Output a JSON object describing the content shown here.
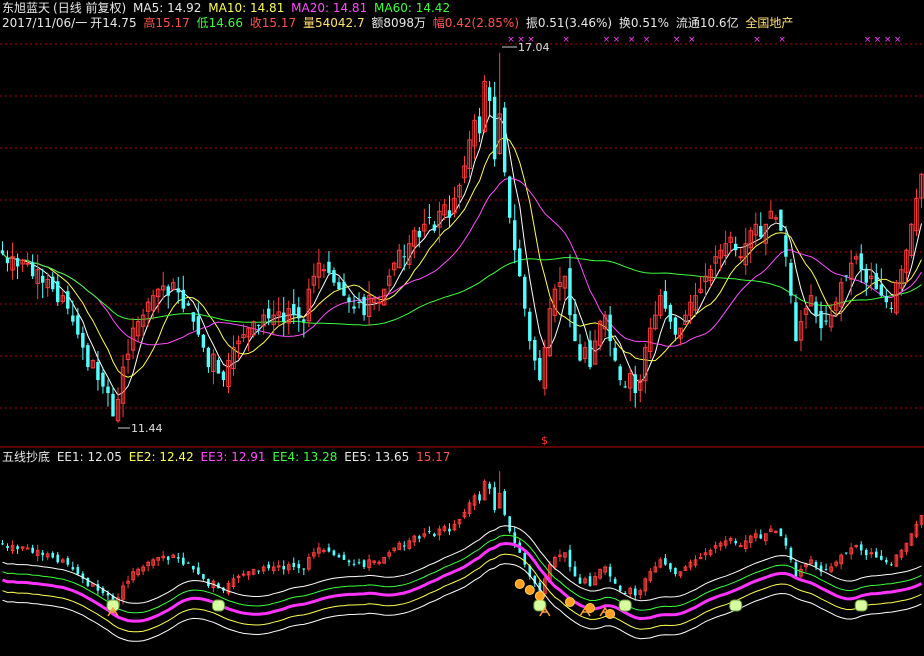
{
  "header": {
    "stock_name": "东旭蓝天",
    "period_label": "(日线 前复权)",
    "ma5": "MA5: 14.92",
    "ma10": "MA10: 14.81",
    "ma20": "MA20: 14.81",
    "ma60": "MA60: 14.42",
    "date": "2017/11/06/一",
    "open": "开14.75",
    "high": "高15.17",
    "low": "低14.66",
    "close": "收15.17",
    "volume": "量54042.7",
    "amount": "额8098万",
    "change": "幅0.42(2.85%)",
    "amplitude": "振0.51(3.46%)",
    "turnover": "换0.51%",
    "float_cap": "流通10.6亿",
    "sector": "全国地产"
  },
  "indicator": {
    "name": "五线抄底",
    "ee1": "EE1: 12.05",
    "ee2": "EE2: 12.42",
    "ee3": "EE3: 12.91",
    "ee4": "EE4: 13.28",
    "ee5": "EE5: 13.65",
    "last": "15.17"
  },
  "colors": {
    "up": "#ff3c3c",
    "down": "#54ffff",
    "ma5": "#ffffff",
    "ma10": "#ffff54",
    "ma20": "#ff4dff",
    "ma60": "#3cff3c",
    "grid": "#b40000",
    "ee_main": "#ff33ff"
  },
  "chart_data": {
    "type": "candlestick",
    "annotations": {
      "max_label": "17.04",
      "min_label": "11.44",
      "marker": "$",
      "x_marks": "×"
    },
    "price_range": [
      11.2,
      17.3
    ],
    "closes": [
      13.95,
      13.8,
      13.9,
      13.75,
      13.85,
      13.8,
      13.6,
      13.7,
      13.5,
      13.55,
      13.4,
      13.2,
      13.3,
      13.1,
      12.9,
      12.7,
      12.5,
      12.2,
      12.3,
      12.0,
      11.9,
      11.8,
      11.44,
      11.7,
      12.2,
      12.4,
      12.8,
      12.9,
      13.0,
      13.2,
      13.3,
      13.4,
      13.45,
      13.3,
      13.5,
      13.35,
      13.1,
      13.15,
      12.9,
      12.7,
      12.5,
      12.2,
      12.4,
      12.1,
      12.0,
      12.3,
      12.5,
      12.6,
      12.7,
      12.8,
      12.9,
      12.85,
      13.0,
      12.95,
      13.0,
      13.05,
      12.9,
      13.1,
      13.0,
      12.95,
      12.9,
      13.4,
      13.6,
      13.8,
      13.7,
      13.65,
      13.5,
      13.4,
      13.3,
      13.2,
      13.1,
      13.2,
      13.0,
      13.3,
      13.25,
      13.2,
      13.4,
      13.6,
      13.8,
      14.0,
      13.9,
      14.1,
      14.3,
      14.2,
      14.4,
      14.5,
      14.3,
      14.6,
      14.7,
      14.5,
      14.8,
      15.0,
      15.3,
      15.7,
      16.0,
      15.8,
      16.6,
      16.3,
      15.4,
      16.1,
      15.2,
      14.5,
      14.0,
      13.6,
      13.1,
      12.6,
      12.3,
      12.0,
      12.5,
      13.1,
      13.4,
      13.5,
      13.6,
      13.0,
      12.6,
      12.3,
      12.5,
      12.2,
      12.6,
      12.9,
      13.0,
      12.6,
      12.3,
      12.0,
      11.9,
      12.1,
      11.8,
      12.0,
      12.5,
      12.8,
      13.0,
      13.3,
      13.1,
      12.9,
      12.7,
      12.8,
      13.0,
      13.2,
      13.3,
      13.4,
      13.6,
      13.7,
      13.9,
      14.0,
      14.1,
      14.2,
      14.0,
      13.9,
      14.1,
      14.3,
      14.4,
      14.2,
      14.4,
      14.6,
      14.5,
      14.3,
      13.9,
      13.3,
      12.6,
      12.9,
      13.1,
      13.3,
      13.0,
      12.8,
      12.9,
      13.0,
      13.2,
      13.5,
      13.6,
      13.8,
      13.9,
      13.7,
      13.5,
      13.6,
      13.4,
      13.3,
      13.2,
      13.1,
      13.5,
      13.7,
      14.0,
      14.4,
      14.8,
      15.17
    ]
  }
}
